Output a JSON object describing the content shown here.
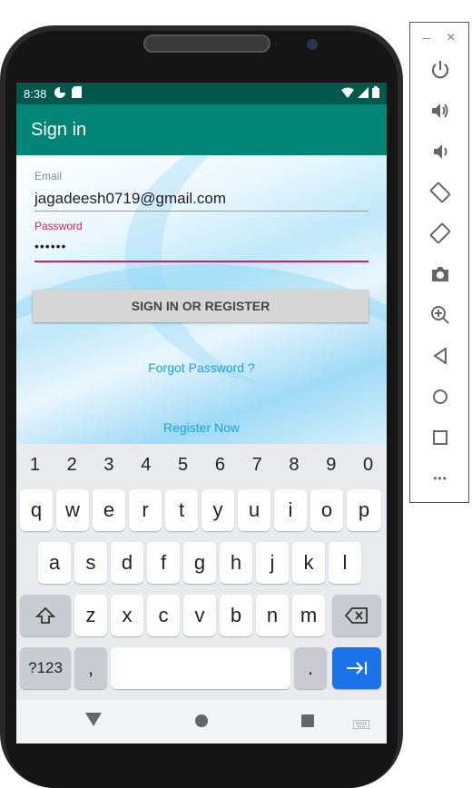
{
  "status_bar": {
    "time": "8:38"
  },
  "app_bar": {
    "title": "Sign in"
  },
  "form": {
    "email_label": "Email",
    "email_value": "jagadeesh0719@gmail.com",
    "password_label": "Password",
    "password_value": "••••••",
    "sign_in_button": "SIGN IN OR REGISTER",
    "forgot_password": "Forgot Password ?",
    "register_now": "Register Now"
  },
  "keyboard": {
    "numbers": [
      "1",
      "2",
      "3",
      "4",
      "5",
      "6",
      "7",
      "8",
      "9",
      "0"
    ],
    "row1": [
      "q",
      "w",
      "e",
      "r",
      "t",
      "y",
      "u",
      "i",
      "o",
      "p"
    ],
    "row2": [
      "a",
      "s",
      "d",
      "f",
      "g",
      "h",
      "j",
      "k",
      "l"
    ],
    "row3": [
      "z",
      "x",
      "c",
      "v",
      "b",
      "n",
      "m"
    ],
    "symbols_key": "?123",
    "comma_key": ",",
    "period_key": "."
  },
  "emulator_panel": {
    "minimize": "–",
    "close": "×",
    "more": "•••"
  },
  "colors": {
    "status_bar": "#00574b",
    "app_bar": "#008577",
    "accent": "#d81b60",
    "link": "#1aa3d9",
    "enter_key": "#1a73e8"
  }
}
